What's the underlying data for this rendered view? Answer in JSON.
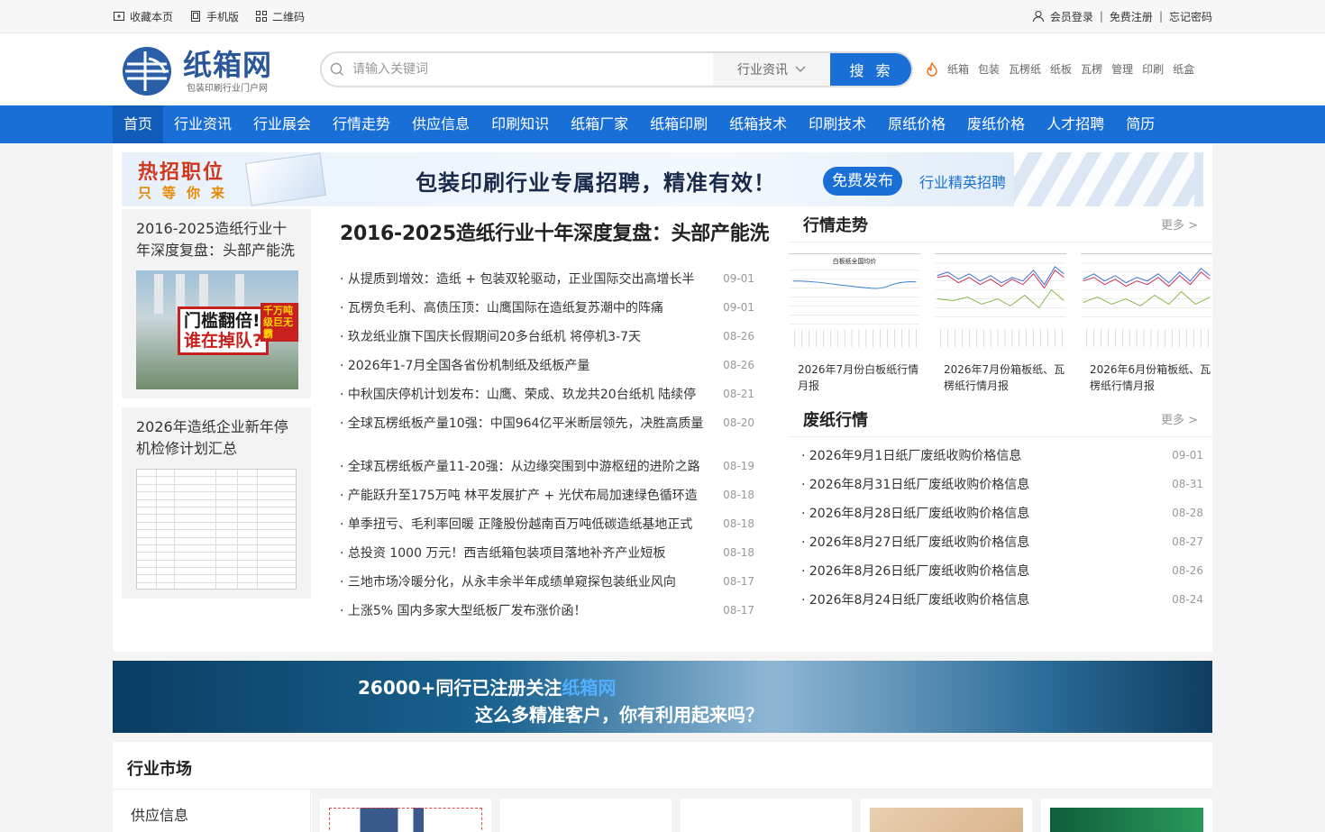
{
  "topbar": {
    "bookmark": "收藏本页",
    "mobile": "手机版",
    "qrcode": "二维码",
    "login": "会员登录",
    "register": "免费注册",
    "forgot": "忘记密码",
    "sep": "|"
  },
  "header": {
    "logo_name": "纸箱网",
    "logo_sub": "包装印刷行业门户网",
    "search_placeholder": "请输入关键词",
    "search_category": "行业资讯",
    "search_button": "搜 索",
    "hotwords": [
      "纸箱",
      "包装",
      "瓦楞纸",
      "纸板",
      "瓦楞",
      "管理",
      "印刷",
      "纸盒"
    ]
  },
  "nav": [
    "首页",
    "行业资讯",
    "行业展会",
    "行情走势",
    "供应信息",
    "印刷知识",
    "纸箱厂家",
    "纸箱印刷",
    "纸箱技术",
    "印刷技术",
    "原纸价格",
    "废纸价格",
    "人才招聘",
    "简历"
  ],
  "banner1": {
    "hot": "热招职位",
    "hot_sub": "只等你来",
    "main": "包装印刷行业专属招聘，精准有效！",
    "button": "免费发布",
    "sub": "行业精英招聘"
  },
  "features": [
    {
      "title": "2016-2025造纸行业十年深度复盘：头部产能洗",
      "img_line1": "门槛翻倍!",
      "img_line2": "谁在掉队?",
      "img_tag": "千万吨级巨无霸"
    },
    {
      "title": "2026年造纸企业新年停机检修计划汇总"
    }
  ],
  "headline": "2016-2025造纸行业十年深度复盘：头部产能洗",
  "news1": [
    {
      "title": "从提质到增效：造纸 + 包装双轮驱动，正业国际交出高增长半",
      "date": "09-01"
    },
    {
      "title": "瓦楞负毛利、高债压顶：山鹰国际在造纸复苏潮中的阵痛",
      "date": "09-01"
    },
    {
      "title": "玖龙纸业旗下国庆长假期间20多台纸机 将停机3-7天",
      "date": "08-26"
    },
    {
      "title": "2026年1-7月全国各省份机制纸及纸板产量",
      "date": "08-26"
    },
    {
      "title": "中秋国庆停机计划发布：山鹰、荣成、玖龙共20台纸机 陆续停",
      "date": "08-21"
    },
    {
      "title": "全球瓦楞纸板产量10强：中国964亿平米断层领先，决胜高质量",
      "date": "08-20"
    }
  ],
  "news2": [
    {
      "title": "全球瓦楞纸板产量11-20强：从边缘突围到中游枢纽的进阶之路",
      "date": "08-19"
    },
    {
      "title": "产能跃升至175万吨 林平发展扩产 + 光伏布局加速绿色循环造",
      "date": "08-18"
    },
    {
      "title": "单季扭亏、毛利率回暖 正隆股份越南百万吨低碳造纸基地正式",
      "date": "08-18"
    },
    {
      "title": "总投资 1000 万元！西吉纸箱包装项目落地补齐产业短板",
      "date": "08-18"
    },
    {
      "title": "三地市场冷暖分化，从永丰余半年成绩单窥探包装纸业风向",
      "date": "08-17"
    },
    {
      "title": "上涨5% 国内多家大型纸板厂发布涨价函！",
      "date": "08-17"
    }
  ],
  "trend": {
    "title": "行情走势",
    "more": "更多 >",
    "chart_title": "白板纸全国均价",
    "cards": [
      {
        "caption": "2026年7月份白板纸行情月报"
      },
      {
        "caption": "2026年7月份箱板纸、瓦楞纸行情月报"
      },
      {
        "caption": "2026年6月份箱板纸、瓦楞纸行情月报"
      }
    ]
  },
  "wastepaper": {
    "title": "废纸行情",
    "more": "更多 >",
    "items": [
      {
        "title": "2026年9月1日纸厂废纸收购价格信息",
        "date": "09-01"
      },
      {
        "title": "2026年8月31日纸厂废纸收购价格信息",
        "date": "08-31"
      },
      {
        "title": "2026年8月28日纸厂废纸收购价格信息",
        "date": "08-28"
      },
      {
        "title": "2026年8月27日纸厂废纸收购价格信息",
        "date": "08-27"
      },
      {
        "title": "2026年8月26日纸厂废纸收购价格信息",
        "date": "08-26"
      },
      {
        "title": "2026年8月24日纸厂废纸收购价格信息",
        "date": "08-24"
      }
    ]
  },
  "banner2": {
    "line1_a": "26000+同行已注册关注",
    "line1_b": "纸箱网",
    "line2": "这么多精准客户，你有利用起来吗？"
  },
  "market": {
    "title": "行业市场",
    "side_label": "供应信息"
  },
  "colors": {
    "brand": "#1a6fd6",
    "nav_active": "#105cb8"
  }
}
